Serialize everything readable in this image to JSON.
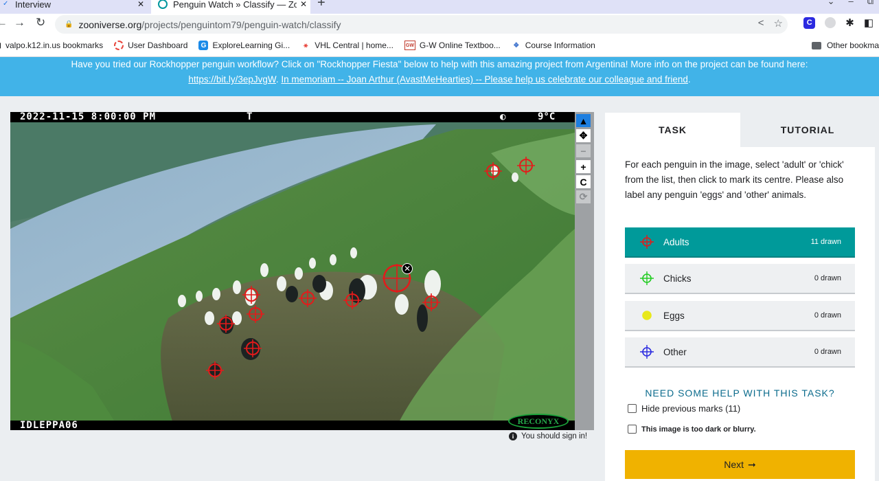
{
  "browser": {
    "tabs": [
      {
        "title": "Interview",
        "active": false
      },
      {
        "title": "Penguin Watch » Classify — Zoo",
        "active": true
      }
    ],
    "url_host": "zooniverse.org",
    "url_path": "/projects/penguintom79/penguin-watch/classify",
    "bookmarks": [
      {
        "label": "valpo.k12.in.us bookmarks",
        "icon": "bookmark-folder-icon"
      },
      {
        "label": "User Dashboard",
        "icon": "dashboard-icon"
      },
      {
        "label": "ExploreLearning Gi...",
        "icon": "gizmos-icon"
      },
      {
        "label": "VHL Central | home...",
        "icon": "vhl-icon"
      },
      {
        "label": "G-W Online Textboo...",
        "icon": "gw-icon"
      },
      {
        "label": "Course Information",
        "icon": "course-icon"
      }
    ],
    "other_bookmarks": "Other bookma"
  },
  "banner": {
    "text": "Have you tried our Rockhopper penguin workflow? Click on \"Rockhopper Fiesta\" below to help with this amazing project from Argentina! More info on the project can be found here:",
    "link1": "https://bit.ly/3epJvgW",
    "link2": "In memoriam -- Joan Arthur (AvastMeHearties) -- Please help us celebrate our colleague and friend",
    "end": "."
  },
  "camera": {
    "datetime": "2022-11-15 8:00:00 PM",
    "flag": "T",
    "moon": "◐",
    "temperature": "9°C",
    "camera_id": "IDLEPPA06",
    "brand": "RECONYX"
  },
  "tools": [
    "pointer-icon",
    "pan-icon",
    "zoom-out-icon",
    "zoom-in-icon",
    "rotate-icon",
    "reset-icon"
  ],
  "signin_notice": "You should sign in!",
  "panel": {
    "tabs": {
      "task": "TASK",
      "tutorial": "TUTORIAL"
    },
    "instructions": "For each penguin in the image, select 'adult' or 'chick' from the list, then click to mark its centre. Please also label any penguin 'eggs' and 'other' animals.",
    "choices": [
      {
        "label": "Adults",
        "count": "11 drawn",
        "color": "#e31b1b",
        "selected": true
      },
      {
        "label": "Chicks",
        "count": "0 drawn",
        "color": "#22cc22",
        "selected": false
      },
      {
        "label": "Eggs",
        "count": "0 drawn",
        "color": "#e8e81a",
        "selected": false
      },
      {
        "label": "Other",
        "count": "0 drawn",
        "color": "#2a2ae0",
        "selected": false
      }
    ],
    "help": "NEED SOME HELP WITH THIS TASK?",
    "hide_marks": "Hide previous marks (11)",
    "too_dark": "This image is too dark or blurry.",
    "next": "Next"
  },
  "colors": {
    "banner": "#41b3e8",
    "selected_choice": "#009a9a",
    "next_button": "#f0b200",
    "mark": "#e31b1b"
  }
}
